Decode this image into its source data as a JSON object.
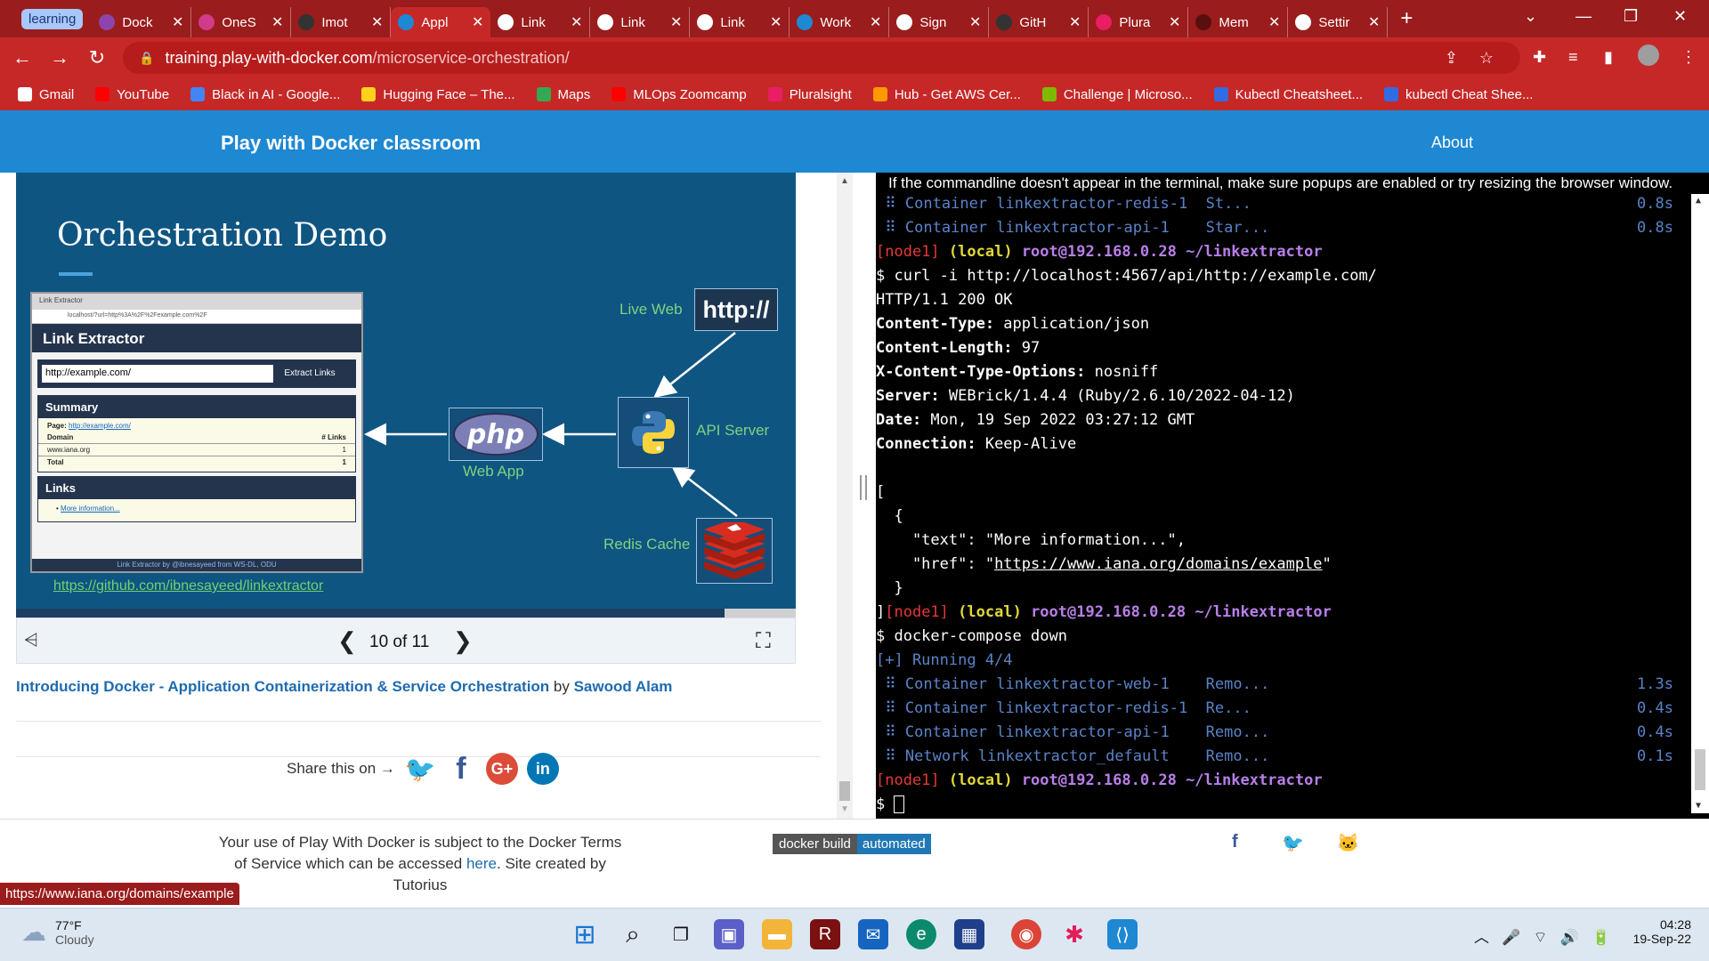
{
  "browser": {
    "tab_group": "learning",
    "tabs": [
      {
        "label": "Dock",
        "icon": "docker-icon",
        "color": "#8e44ad"
      },
      {
        "label": "OneS",
        "icon": "onestep-icon",
        "color": "#d23a8a"
      },
      {
        "label": "Imot",
        "icon": "github-icon",
        "color": "#333333"
      },
      {
        "label": "Appl",
        "icon": "docker-whale-icon",
        "color": "#1e88d2",
        "active": true
      },
      {
        "label": "Link",
        "icon": "globe-icon",
        "color": "#ffffff"
      },
      {
        "label": "Link",
        "icon": "globe-icon",
        "color": "#ffffff"
      },
      {
        "label": "Link",
        "icon": "globe-icon",
        "color": "#ffffff"
      },
      {
        "label": "Work",
        "icon": "vscode-icon",
        "color": "#1e88d2"
      },
      {
        "label": "Sign",
        "icon": "globe-icon",
        "color": "#ffffff"
      },
      {
        "label": "GitH",
        "icon": "github-icon",
        "color": "#333333"
      },
      {
        "label": "Plura",
        "icon": "pluralsight-icon",
        "color": "#e91e63"
      },
      {
        "label": "Mem",
        "icon": "r-icon",
        "color": "#5a0f0f"
      },
      {
        "label": "Settir",
        "icon": "gear-icon",
        "color": "#ffffff"
      }
    ],
    "url_host": "training.play-with-docker.com",
    "url_path": "/microservice-orchestration/",
    "bookmarks": [
      {
        "label": "Gmail",
        "color": "#ffffff"
      },
      {
        "label": "YouTube",
        "color": "#ff0000"
      },
      {
        "label": "Black in AI - Google...",
        "color": "#4285f4"
      },
      {
        "label": "Hugging Face – The...",
        "color": "#ffd21e"
      },
      {
        "label": "Maps",
        "color": "#34a853"
      },
      {
        "label": "MLOps Zoomcamp",
        "color": "#ff0000"
      },
      {
        "label": "Pluralsight",
        "color": "#e91e63"
      },
      {
        "label": "Hub - Get AWS Cer...",
        "color": "#ff9900"
      },
      {
        "label": "Challenge | Microso...",
        "color": "#7fba00"
      },
      {
        "label": "Kubectl Cheatsheet...",
        "color": "#326ce5"
      },
      {
        "label": "kubectl Cheat Shee...",
        "color": "#326ce5"
      }
    ]
  },
  "site": {
    "title": "Play with Docker classroom",
    "about": "About"
  },
  "slide": {
    "title": "Orchestration Demo",
    "mock_tab": "Link Extractor",
    "mock_url": "localhost/?url=http%3A%2F%2Fexample.com%2F",
    "app_title": "Link Extractor",
    "input_value": "http://example.com/",
    "extract_button": "Extract Links",
    "summary_heading": "Summary",
    "page_label": "Page:",
    "page_link": "http://example.com/",
    "col_domain": "Domain",
    "col_links": "# Links",
    "row_domain": "www.iana.org",
    "row_count": "1",
    "total_label": "Total",
    "total_count": "1",
    "links_heading": "Links",
    "links_item": "More information...",
    "mock_footer": "Link Extractor by @ibnesayeed from WS-DL, ODU",
    "live_web": "Live Web",
    "http_label": "http://",
    "api_server": "API Server",
    "web_app": "Web App",
    "php_label": "php",
    "redis_cache": "Redis Cache",
    "repo_link": "https://github.com/ibnesayeed/linkextractor",
    "current": 10,
    "total": 11,
    "counter": "10 of 11"
  },
  "caption": {
    "title": "Introducing Docker - Application Containerization & Service Orchestration",
    "by": " by ",
    "author": "Sawood Alam"
  },
  "share": {
    "label": "Share this on →"
  },
  "terminal": {
    "notice": "If the commandline doesn't appear in the terminal, make sure popups are enabled or try resizing the browser window.",
    "lines": {
      "l1": " ⠿ Container linkextractor-redis-1  St...",
      "l1t": "0.8s",
      "l2": " ⠿ Container linkextractor-api-1    Star...",
      "l2t": "0.8s",
      "prompt_node": "[node1]",
      "prompt_local": "(local)",
      "prompt_user": "root@192.168.0.28",
      "prompt_dir": "~/linkextractor",
      "cmd1": "$ curl -i http://localhost:4567/api/http://example.com/",
      "status": "HTTP/1.1 200 OK",
      "h1k": "Content-Type:",
      "h1v": " application/json",
      "h2k": "Content-Length:",
      "h2v": " 97",
      "h3k": "X-Content-Type-Options:",
      "h3v": " nosniff",
      "h4k": "Server:",
      "h4v": " WEBrick/1.4.4 (Ruby/2.6.10/2022-04-12)",
      "h5k": "Date:",
      "h5v": " Mon, 19 Sep 2022 03:27:12 GMT",
      "h6k": "Connection:",
      "h6v": " Keep-Alive",
      "j1": "[",
      "j2": "  {",
      "j3": "    \"text\": \"More information...\",",
      "j4a": "    \"href\": \"",
      "j4b": "https://www.iana.org/domains/example",
      "j4c": "\"",
      "j5": "  }",
      "j6": "]",
      "cmd2": "$ docker-compose down",
      "running": "[+] Running 4/4",
      "d1": " ⠿ Container linkextractor-web-1    Remo...",
      "d1t": "1.3s",
      "d2": " ⠿ Container linkextractor-redis-1  Re...",
      "d2t": "0.4s",
      "d3": " ⠿ Container linkextractor-api-1    Remo...",
      "d3t": "0.4s",
      "d4": " ⠿ Network linkextractor_default    Remo...",
      "d4t": "0.1s",
      "cursor_prompt": "$ "
    }
  },
  "footer": {
    "tos_1": "Your use of Play With Docker is subject to the Docker Terms of Service which can be accessed ",
    "tos_link": "here",
    "tos_2": ". Site created by Tutorius",
    "badge_left": "docker build",
    "badge_right": "automated"
  },
  "status_link": "https://www.iana.org/domains/example",
  "taskbar": {
    "temp": "77°F",
    "condition": "Cloudy",
    "time": "04:28",
    "date": "19-Sep-22"
  }
}
